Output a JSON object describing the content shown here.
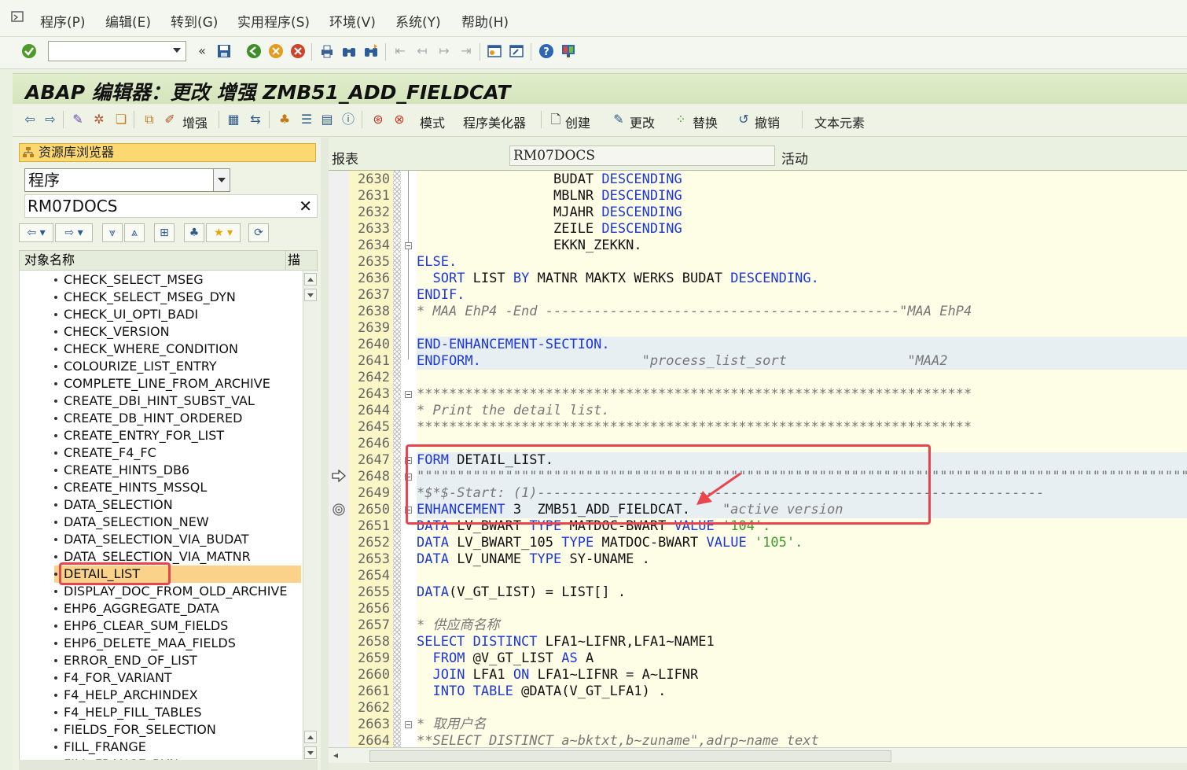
{
  "menu": {
    "items": [
      "程序(P)",
      "编辑(E)",
      "转到(G)",
      "实用程序(S)",
      "环境(V)",
      "系统(Y)",
      "帮助(H)"
    ]
  },
  "system_toolbar": {
    "command_field_value": "",
    "icons": [
      "enter-check-icon",
      "save-icon",
      "back-icon",
      "exit-icon",
      "cancel-icon",
      "print-icon",
      "find-icon",
      "find-next-icon",
      "first-page-icon",
      "prev-page-icon",
      "next-page-icon",
      "last-page-icon",
      "new-session-icon",
      "shortcut-icon",
      "help-icon",
      "layout-icon"
    ]
  },
  "title": "ABAP 编辑器：更改 增强 ZMB51_ADD_FIELDCAT",
  "app_toolbar": {
    "enhance": "增强",
    "pattern": "模式",
    "pretty_printer": "程序美化器",
    "create": "创建",
    "change": "更改",
    "replace": "替换",
    "undo": "撤销",
    "text_elements": "文本元素"
  },
  "repository": {
    "header": "资源库浏览器",
    "object_type": "程序",
    "object_name": "RM07DOCS",
    "column_name": "对象名称",
    "column_desc": "描",
    "items": [
      "CHECK_SELECT_MSEG",
      "CHECK_SELECT_MSEG_DYN",
      "CHECK_UI_OPTI_BADI",
      "CHECK_VERSION",
      "CHECK_WHERE_CONDITION",
      "COLOURIZE_LIST_ENTRY",
      "COMPLETE_LINE_FROM_ARCHIVE",
      "CREATE_DBI_HINT_SUBST_VAL",
      "CREATE_DB_HINT_ORDERED",
      "CREATE_ENTRY_FOR_LIST",
      "CREATE_F4_FC",
      "CREATE_HINTS_DB6",
      "CREATE_HINTS_MSSQL",
      "DATA_SELECTION",
      "DATA_SELECTION_NEW",
      "DATA_SELECTION_VIA_BUDAT",
      "DATA_SELECTION_VIA_MATNR",
      "DETAIL_LIST",
      "DISPLAY_DOC_FROM_OLD_ARCHIVE",
      "EHP6_AGGREGATE_DATA",
      "EHP6_CLEAR_SUM_FIELDS",
      "EHP6_DELETE_MAA_FIELDS",
      "ERROR_END_OF_LIST",
      "F4_FOR_VARIANT",
      "F4_HELP_ARCHINDEX",
      "F4_HELP_FILL_TABLES",
      "FIELDS_FOR_SELECTION",
      "FILL_FRANGE",
      "FILL_FRANGE_DYN"
    ],
    "selected_index": 17
  },
  "editor": {
    "report_label": "报表",
    "program": "RM07DOCS",
    "status": "活动",
    "lines": [
      {
        "n": "2630",
        "segs": [
          [
            "",
            "                 BUDAT "
          ],
          [
            "kw",
            "DESCENDING"
          ]
        ]
      },
      {
        "n": "2631",
        "segs": [
          [
            "",
            "                 MBLNR "
          ],
          [
            "kw",
            "DESCENDING"
          ]
        ]
      },
      {
        "n": "2632",
        "segs": [
          [
            "",
            "                 MJAHR "
          ],
          [
            "kw",
            "DESCENDING"
          ]
        ]
      },
      {
        "n": "2633",
        "segs": [
          [
            "",
            "                 ZEILE "
          ],
          [
            "kw",
            "DESCENDING"
          ]
        ]
      },
      {
        "n": "2634",
        "segs": [
          [
            "",
            "                 EKKN_ZEKKN."
          ]
        ]
      },
      {
        "n": "2635",
        "segs": [
          [
            "kw",
            "ELSE."
          ]
        ]
      },
      {
        "n": "2636",
        "segs": [
          [
            "",
            "  "
          ],
          [
            "kw",
            "SORT"
          ],
          [
            "",
            " LIST "
          ],
          [
            "kw",
            "BY"
          ],
          [
            "",
            " MATNR MAKTX WERKS BUDAT "
          ],
          [
            "kw",
            "DESCENDING."
          ]
        ]
      },
      {
        "n": "2637",
        "segs": [
          [
            "kw",
            "ENDIF."
          ]
        ]
      },
      {
        "n": "2638",
        "segs": [
          [
            "cm",
            "* MAA EhP4 -End --------------------------------------------\"MAA EhP4"
          ]
        ]
      },
      {
        "n": "2639",
        "segs": [
          [
            "",
            ""
          ]
        ]
      },
      {
        "n": "2640",
        "segs": [
          [
            "kw",
            "END-ENHANCEMENT-SECTION."
          ]
        ],
        "dim": true
      },
      {
        "n": "2641",
        "segs": [
          [
            "kw",
            "ENDFORM."
          ],
          [
            "cm",
            "                    \"process_list_sort               \"MAA2"
          ]
        ],
        "dim": true
      },
      {
        "n": "2642",
        "segs": [
          [
            "",
            ""
          ]
        ]
      },
      {
        "n": "2643",
        "segs": [
          [
            "cm",
            "*********************************************************************"
          ]
        ]
      },
      {
        "n": "2644",
        "segs": [
          [
            "cm",
            "* Print the detail list."
          ]
        ]
      },
      {
        "n": "2645",
        "segs": [
          [
            "cm",
            "*********************************************************************"
          ]
        ]
      },
      {
        "n": "2646",
        "segs": [
          [
            "",
            ""
          ]
        ]
      },
      {
        "n": "2647",
        "segs": [
          [
            "kw",
            "FORM"
          ],
          [
            "",
            " DETAIL_LIST."
          ]
        ],
        "dim": true
      },
      {
        "n": "2648",
        "segs": [
          [
            "cm",
            "\"\"\"\"\"\"\"\"\"\"\"\"\"\"\"\"\"\"\"\"\"\"\"\"\"\"\"\"\"\"\"\"\"\"\"\"\"\"\"\"\"\"\"\"\"\"\"\"\"\"\"\"\"\"\"\"\"\"\"\"\"\"\"\"\"\"\"\"\"\"\"\"\"\"\"\"\"\"\"\"\"\"\"\"\"\"\"\"\"\"\"\"\"\"\"\"\"\"\"\"\"\"\"\"\"\"\"\"\"\"\"\"\"\"\"\"\"\"\"\"\"\"\"\"\"\"\"\"\"\"\"\"\"\"\"\"\"\"\"\"\"\"\"\"\"\"\"\"\"\"\"\"\"\"\"\"\"\"\"\"\"\"\"\"\"\"\"\"\"\"\"\"\"\"\"\"\"\"\"\"\"\"\"\"\"\"\"\"\"\"\"\"\"\"\"\"\"\"\"\"\"\"\"\"\"\"\"\"\"\"\"\"\"\"\"\"\"\"\"\"\"\"\"\"\"\"\"\"\"\"\"\"\"\"\"\"\"\"\"\""
          ]
        ],
        "dim": true
      },
      {
        "n": "2649",
        "segs": [
          [
            "cm",
            "*$*$-Start: (1)---------------------------------------------------------------"
          ]
        ],
        "dim": true
      },
      {
        "n": "2650",
        "segs": [
          [
            "kw",
            "ENHANCEMENT"
          ],
          [
            "",
            " 3  ZMB51_ADD_FIELDCAT.    "
          ],
          [
            "cm",
            "\"active version"
          ]
        ],
        "dim": true
      },
      {
        "n": "2651",
        "segs": [
          [
            "kw",
            "DATA"
          ],
          [
            "",
            " LV_BWART "
          ],
          [
            "kw",
            "TYPE"
          ],
          [
            "",
            " MATDOC-BWART "
          ],
          [
            "kw",
            "VALUE"
          ],
          [
            "st",
            " '104'."
          ]
        ]
      },
      {
        "n": "2652",
        "segs": [
          [
            "kw",
            "DATA"
          ],
          [
            "",
            " LV_BWART_105 "
          ],
          [
            "kw",
            "TYPE"
          ],
          [
            "",
            " MATDOC-BWART "
          ],
          [
            "kw",
            "VALUE"
          ],
          [
            "st",
            " '105'."
          ]
        ]
      },
      {
        "n": "2653",
        "segs": [
          [
            "kw",
            "DATA"
          ],
          [
            "",
            " LV_UNAME "
          ],
          [
            "kw",
            "TYPE"
          ],
          [
            "",
            " SY-UNAME ."
          ]
        ]
      },
      {
        "n": "2654",
        "segs": [
          [
            "",
            ""
          ]
        ]
      },
      {
        "n": "2655",
        "segs": [
          [
            "kw",
            "DATA"
          ],
          [
            "",
            "(V_GT_LIST) = LIST[] ."
          ]
        ]
      },
      {
        "n": "2656",
        "segs": [
          [
            "",
            ""
          ]
        ]
      },
      {
        "n": "2657",
        "segs": [
          [
            "cm",
            "* 供应商名称"
          ]
        ]
      },
      {
        "n": "2658",
        "segs": [
          [
            "kw",
            "SELECT DISTINCT"
          ],
          [
            "",
            " LFA1~LIFNR,LFA1~NAME1"
          ]
        ]
      },
      {
        "n": "2659",
        "segs": [
          [
            "",
            "  "
          ],
          [
            "kw",
            "FROM"
          ],
          [
            "",
            " @V_GT_LIST "
          ],
          [
            "kw",
            "AS"
          ],
          [
            "",
            " A"
          ]
        ]
      },
      {
        "n": "2660",
        "segs": [
          [
            "",
            "  "
          ],
          [
            "kw",
            "JOIN"
          ],
          [
            "",
            " LFA1 "
          ],
          [
            "kw",
            "ON"
          ],
          [
            "",
            " LFA1~LIFNR = A~LIFNR"
          ]
        ]
      },
      {
        "n": "2661",
        "segs": [
          [
            "",
            "  "
          ],
          [
            "kw",
            "INTO TABLE"
          ],
          [
            "",
            " @DATA(V_GT_LFA1) ."
          ]
        ]
      },
      {
        "n": "2662",
        "segs": [
          [
            "",
            ""
          ]
        ]
      },
      {
        "n": "2663",
        "segs": [
          [
            "cm",
            "* 取用户名"
          ]
        ]
      },
      {
        "n": "2664",
        "segs": [
          [
            "cm",
            "**SELECT DISTINCT a~bktxt,b~zuname\",adrp~name_text"
          ]
        ]
      }
    ]
  }
}
